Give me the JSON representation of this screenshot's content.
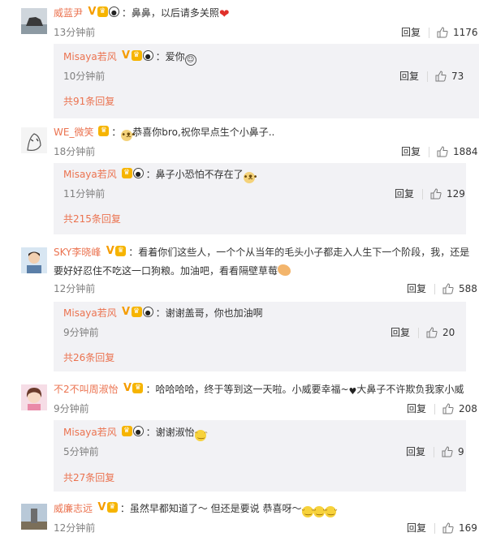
{
  "comments": [
    {
      "username": "威蓝尹",
      "colon": "：",
      "text": "鼻鼻，以后请多关照",
      "time": "13分钟前",
      "reply_label": "回复",
      "likes": "1176",
      "replies": [
        {
          "username": "Misaya若风",
          "colon": "：",
          "text": "爱你",
          "time": "10分钟前",
          "reply_label": "回复",
          "likes": "73"
        }
      ],
      "more": "共91条回复"
    },
    {
      "username": "WE_微笑",
      "colon": "：",
      "text": "恭喜你bro,祝你早点生个小鼻子..",
      "time": "18分钟前",
      "reply_label": "回复",
      "likes": "1884",
      "replies": [
        {
          "username": "Misaya若风",
          "colon": "：",
          "text": "鼻子小恐怕不存在了",
          "time": "11分钟前",
          "reply_label": "回复",
          "likes": "129"
        }
      ],
      "more": "共215条回复"
    },
    {
      "username": "SKY李晓峰",
      "colon": "：",
      "text": "看着你们这些人，一个个从当年的毛头小子都走入人生下一个阶段，我，还是",
      "text2": "要好好忍住不吃这一口狗粮。加油吧，看看隔壁草莓",
      "time": "12分钟前",
      "reply_label": "回复",
      "likes": "588",
      "replies": [
        {
          "username": "Misaya若风",
          "colon": "：",
          "text": "谢谢盖哥，你也加油啊",
          "time": "9分钟前",
          "reply_label": "回复",
          "likes": "20"
        }
      ],
      "more": "共26条回复"
    },
    {
      "username": "不2不叫周淑怡",
      "colon": "：",
      "text": "哈哈哈哈，终于等到这一天啦。小威要幸福~",
      "text_b": "大鼻子不许欺负我家小威",
      "time": "9分钟前",
      "reply_label": "回复",
      "likes": "208",
      "replies": [
        {
          "username": "Misaya若风",
          "colon": "：",
          "text": "谢谢淑怡",
          "time": "5分钟前",
          "reply_label": "回复",
          "likes": "9"
        }
      ],
      "more": "共27条回复"
    },
    {
      "username": "威廉志远",
      "colon": "：",
      "text": "虽然早都知道了～ 但还是要说  恭喜呀～",
      "time": "12分钟前",
      "reply_label": "回复",
      "likes": "169"
    }
  ],
  "icons": {
    "like": "thumbs-up-icon",
    "verified": "verified-v-icon",
    "member": "member-crown-icon",
    "panda": "panda-icon"
  },
  "colors": {
    "username": "#eb7350",
    "sub_bg": "#f2f2f5",
    "meta": "#808080"
  }
}
